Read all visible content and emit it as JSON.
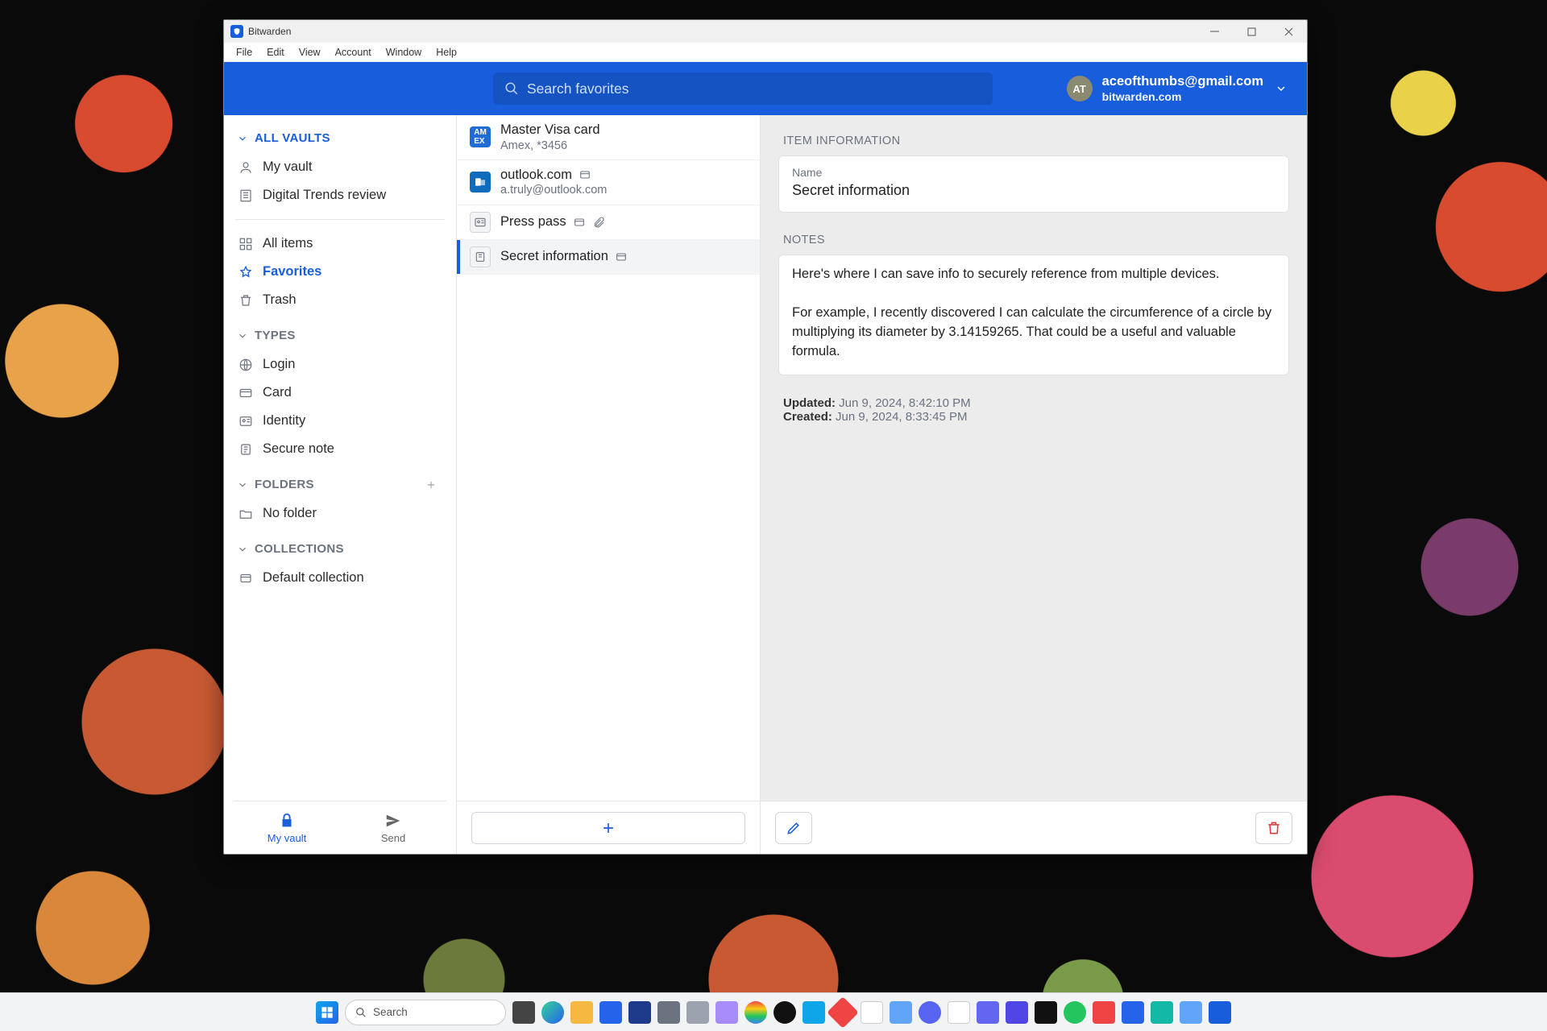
{
  "window": {
    "title": "Bitwarden"
  },
  "menu": {
    "file": "File",
    "edit": "Edit",
    "view": "View",
    "account": "Account",
    "window": "Window",
    "help": "Help"
  },
  "search": {
    "placeholder": "Search favorites"
  },
  "account": {
    "initials": "AT",
    "email": "aceofthumbs@gmail.com",
    "domain": "bitwarden.com"
  },
  "sidebar": {
    "all_vaults": "ALL VAULTS",
    "vaults": [
      {
        "label": "My vault",
        "icon": "user-icon"
      },
      {
        "label": "Digital Trends review",
        "icon": "org-icon"
      }
    ],
    "filters": [
      {
        "label": "All items",
        "icon": "grid-icon"
      },
      {
        "label": "Favorites",
        "icon": "star-icon",
        "active": true
      },
      {
        "label": "Trash",
        "icon": "trash-icon"
      }
    ],
    "types_label": "TYPES",
    "types": [
      {
        "label": "Login",
        "icon": "globe-icon"
      },
      {
        "label": "Card",
        "icon": "card-icon"
      },
      {
        "label": "Identity",
        "icon": "identity-icon"
      },
      {
        "label": "Secure note",
        "icon": "note-icon"
      }
    ],
    "folders_label": "FOLDERS",
    "folders": [
      {
        "label": "No folder",
        "icon": "folder-icon"
      }
    ],
    "collections_label": "COLLECTIONS",
    "collections": [
      {
        "label": "Default collection",
        "icon": "collection-icon"
      }
    ],
    "tabs": {
      "vault": "My vault",
      "send": "Send"
    }
  },
  "items": [
    {
      "title": "Master Visa card",
      "sub": "Amex, *3456",
      "icon": "amex"
    },
    {
      "title": "outlook.com",
      "sub": "a.truly@outlook.com",
      "icon": "outlook",
      "launch": true
    },
    {
      "title": "Press pass",
      "icon": "id",
      "launch": true,
      "attach": true
    },
    {
      "title": "Secret information",
      "icon": "note",
      "launch": true,
      "selected": true
    }
  ],
  "detail": {
    "section_info": "ITEM INFORMATION",
    "name_label": "Name",
    "name_value": "Secret information",
    "section_notes": "NOTES",
    "notes": "Here's where I can save info to securely reference from multiple devices.\n\nFor example, I recently discovered I can calculate the circumference of a circle by multiplying its diameter by 3.14159265. That could be a useful and valuable formula.",
    "updated_label": "Updated:",
    "updated_value": "Jun 9, 2024, 8:42:10 PM",
    "created_label": "Created:",
    "created_value": "Jun 9, 2024, 8:33:45 PM"
  },
  "taskbar": {
    "search": "Search"
  }
}
